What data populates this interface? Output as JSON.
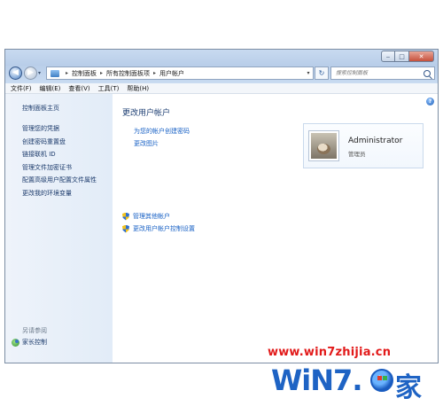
{
  "window": {
    "controls": {
      "minimize": "‒",
      "maximize": "□",
      "close": "✕"
    }
  },
  "nav": {
    "back_glyph": "◀",
    "forward_glyph": "▶",
    "recent_glyph": "▾",
    "breadcrumbs": [
      "控制面板",
      "所有控制面板项",
      "用户帐户"
    ],
    "crumb_separator": "▸",
    "refresh_glyph": "↻",
    "search_placeholder": "搜索控制面板"
  },
  "menubar": {
    "items": [
      "文件(F)",
      "编辑(E)",
      "查看(V)",
      "工具(T)",
      "帮助(H)"
    ]
  },
  "sidebar": {
    "home": "控制面板主页",
    "links": [
      "管理您的凭据",
      "创建密码重置盘",
      "链接联机 ID",
      "管理文件加密证书",
      "配置高级用户配置文件属性",
      "更改我的环境变量"
    ],
    "see_also": "另请参阅",
    "parental_controls": "家长控制"
  },
  "main": {
    "help_glyph": "?",
    "title": "更改用户帐户",
    "link_create_password": "为您的帐户创建密码",
    "link_change_picture": "更改图片",
    "link_manage_accounts": "管理其他帐户",
    "link_uac_settings": "更改用户帐户控制设置"
  },
  "account": {
    "name": "Administrator",
    "role": "管理员"
  },
  "watermark": {
    "url": "www.win7zhijia.cn",
    "logo_text": "WiN7.",
    "logo_suffix": "家"
  }
}
